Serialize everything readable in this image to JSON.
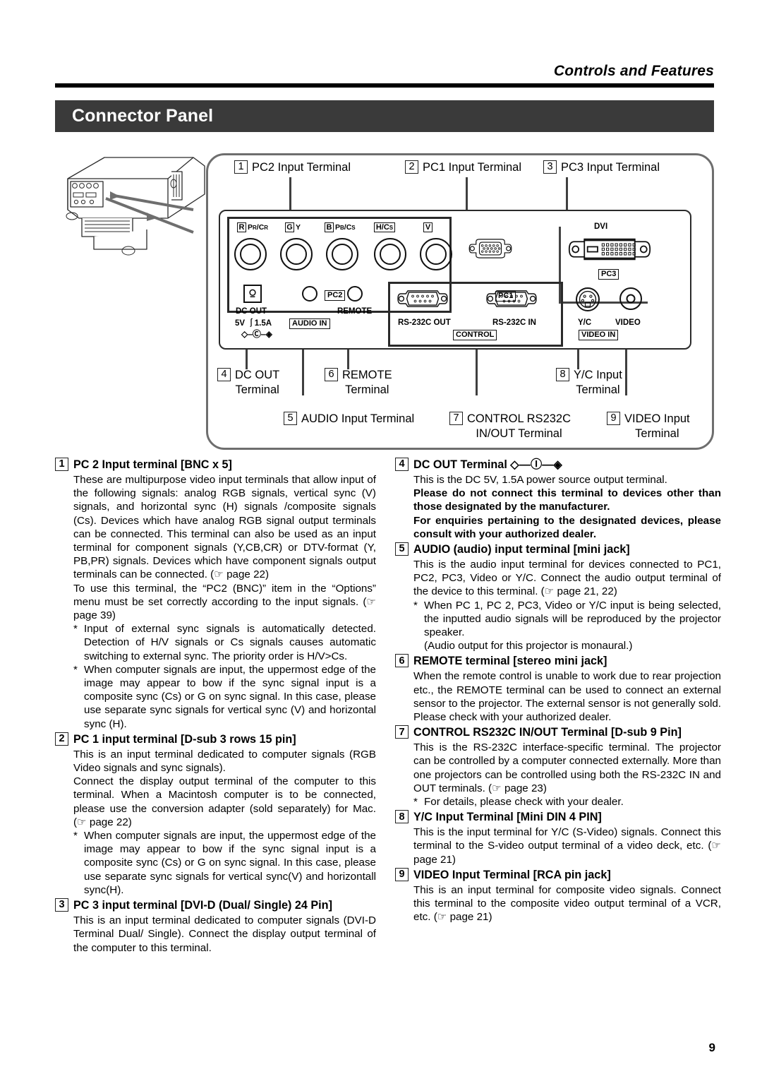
{
  "header": {
    "title": "Controls and Features",
    "section_title": "Connector Panel"
  },
  "diagram": {
    "callouts": [
      {
        "num": "1",
        "line1": "PC2 Input Terminal",
        "line2": ""
      },
      {
        "num": "2",
        "line1": "PC1 Input Terminal",
        "line2": ""
      },
      {
        "num": "3",
        "line1": "PC3 Input Terminal",
        "line2": ""
      },
      {
        "num": "4",
        "line1": "DC OUT",
        "line2": "Terminal"
      },
      {
        "num": "5",
        "line1": "AUDIO Input Terminal",
        "line2": ""
      },
      {
        "num": "6",
        "line1": "REMOTE",
        "line2": "Terminal"
      },
      {
        "num": "7",
        "line1": "CONTROL RS232C",
        "line2": "IN/OUT Terminal"
      },
      {
        "num": "8",
        "line1": "Y/C Input",
        "line2": "Terminal"
      },
      {
        "num": "9",
        "line1": "VIDEO Input",
        "line2": "Terminal"
      }
    ],
    "panel": {
      "bnc": [
        {
          "box": "R",
          "label": "PR/CR"
        },
        {
          "box": "G",
          "label": "Y"
        },
        {
          "box": "B",
          "label": "PB/CS"
        },
        {
          "box": "H/CS",
          "label": ""
        },
        {
          "box": "V",
          "label": ""
        }
      ],
      "tags": {
        "pc2": "PC2",
        "pc1": "PC1",
        "pc3": "PC3",
        "audio_in": "AUDIO IN",
        "control": "CONTROL",
        "video_in": "VIDEO IN"
      },
      "labels": {
        "dvi": "DVI",
        "dc_out": "DC OUT",
        "dc_out_rating": "5V ⏚1.5A",
        "remote": "REMOTE",
        "rs232c_out": "RS-232C OUT",
        "rs232c_in": "RS-232C IN",
        "yc": "Y/C",
        "video": "VIDEO"
      }
    }
  },
  "left_column": [
    {
      "num": "1",
      "heading": "PC 2 Input terminal [BNC x 5]",
      "blocks": [
        {
          "type": "para",
          "text": "These are multipurpose video input terminals that allow input of the following signals: analog RGB signals, vertical sync (V) signals, and horizontal sync (H) signals /composite signals (Cs). Devices which have analog RGB signal output terminals can be connected. This terminal can also be used as an input terminal for component signals (Y,CB,CR) or DTV-format (Y, PB,PR) signals. Devices which have component signals output terminals can be connected. (☞ page 22)"
        },
        {
          "type": "para",
          "text": "To use this terminal, the “PC2 (BNC)” item in the “Options” menu must be set correctly according to the input signals. (☞ page 39)"
        },
        {
          "type": "bullet",
          "text": "Input of external sync signals is automatically detected. Detection of H/V signals or Cs signals causes automatic switching to external sync. The priority order is H/V>Cs."
        },
        {
          "type": "bullet",
          "text": "When computer signals are input, the uppermost edge of the image may appear to bow if the sync signal input is a composite sync (Cs) or G on sync signal. In this case, please use separate sync signals for vertical sync (V) and horizontal sync (H)."
        }
      ]
    },
    {
      "num": "2",
      "heading": "PC 1 input terminal [D-sub 3 rows 15 pin]",
      "blocks": [
        {
          "type": "para",
          "text": "This is an input terminal dedicated to computer signals (RGB Video signals and sync signals)."
        },
        {
          "type": "para",
          "text": "Connect the display output terminal of the computer to this terminal. When a Macintosh computer is to be connected, please use the conversion adapter (sold separately) for Mac. (☞ page 22)"
        },
        {
          "type": "bullet",
          "text": "When computer signals are input, the uppermost edge of the image may appear to bow if the sync signal input is a composite sync (Cs) or G on sync signal. In this case, please use separate sync signals for vertical sync(V) and horizontall sync(H)."
        }
      ]
    },
    {
      "num": "3",
      "heading": "PC 3 input terminal [DVI-D (Dual/ Single) 24 Pin]",
      "blocks": [
        {
          "type": "para",
          "text": "This is an input terminal dedicated to computer signals (DVI-D Terminal Dual/ Single). Connect the display output terminal of the computer to this terminal."
        }
      ]
    }
  ],
  "right_column": [
    {
      "num": "4",
      "heading": "DC OUT Terminal ◇―Ⓘ―◈",
      "blocks": [
        {
          "type": "para",
          "text": "This is the DC 5V, 1.5A power source output terminal."
        },
        {
          "type": "para",
          "bold": true,
          "text": "Please do not connect this terminal to devices other than those designated by the manufacturer."
        },
        {
          "type": "para",
          "bold": true,
          "text": "For enquiries pertaining to the designated devices, please consult with your authorized dealer."
        }
      ]
    },
    {
      "num": "5",
      "heading": "AUDIO (audio) input terminal [mini jack]",
      "blocks": [
        {
          "type": "para",
          "text": "This is the audio input terminal for devices connected to PC1, PC2, PC3, Video or Y/C. Connect the audio output terminal of the device to this terminal. (☞ page 21, 22)"
        },
        {
          "type": "bullet",
          "text": "When PC 1, PC 2, PC3, Video or Y/C input is being selected, the inputted audio signals will be reproduced by the projector speaker."
        },
        {
          "type": "note",
          "text": "(Audio output for this projector is monaural.)"
        }
      ]
    },
    {
      "num": "6",
      "heading": "REMOTE terminal [stereo mini jack]",
      "blocks": [
        {
          "type": "para",
          "text": "When the remote control is unable to work due to rear projection etc., the REMOTE terminal can be used to connect an external sensor to the projector. The external sensor is not generally sold. Please check with your authorized dealer."
        }
      ]
    },
    {
      "num": "7",
      "heading": "CONTROL RS232C IN/OUT Terminal [D-sub 9 Pin]",
      "blocks": [
        {
          "type": "para",
          "text": "This is the RS-232C interface-specific terminal. The projector can be controlled by a computer connected externally. More than one projectors can be controlled using both the RS-232C IN and OUT terminals. (☞ page 23)"
        },
        {
          "type": "bullet",
          "text": "For details, please check with your dealer."
        }
      ]
    },
    {
      "num": "8",
      "heading": "Y/C Input Terminal [Mini DIN 4 PIN]",
      "blocks": [
        {
          "type": "para",
          "text": "This is the input terminal for Y/C (S-Video) signals. Connect this terminal to the S-video output terminal of a video deck, etc. (☞ page 21)"
        }
      ]
    },
    {
      "num": "9",
      "heading": "VIDEO Input Terminal [RCA pin jack]",
      "blocks": [
        {
          "type": "para",
          "text": "This is an input terminal for composite video signals. Connect this terminal to the composite video output terminal of a VCR, etc. (☞ page 21)"
        }
      ]
    }
  ],
  "footer": {
    "page_number": "9"
  }
}
